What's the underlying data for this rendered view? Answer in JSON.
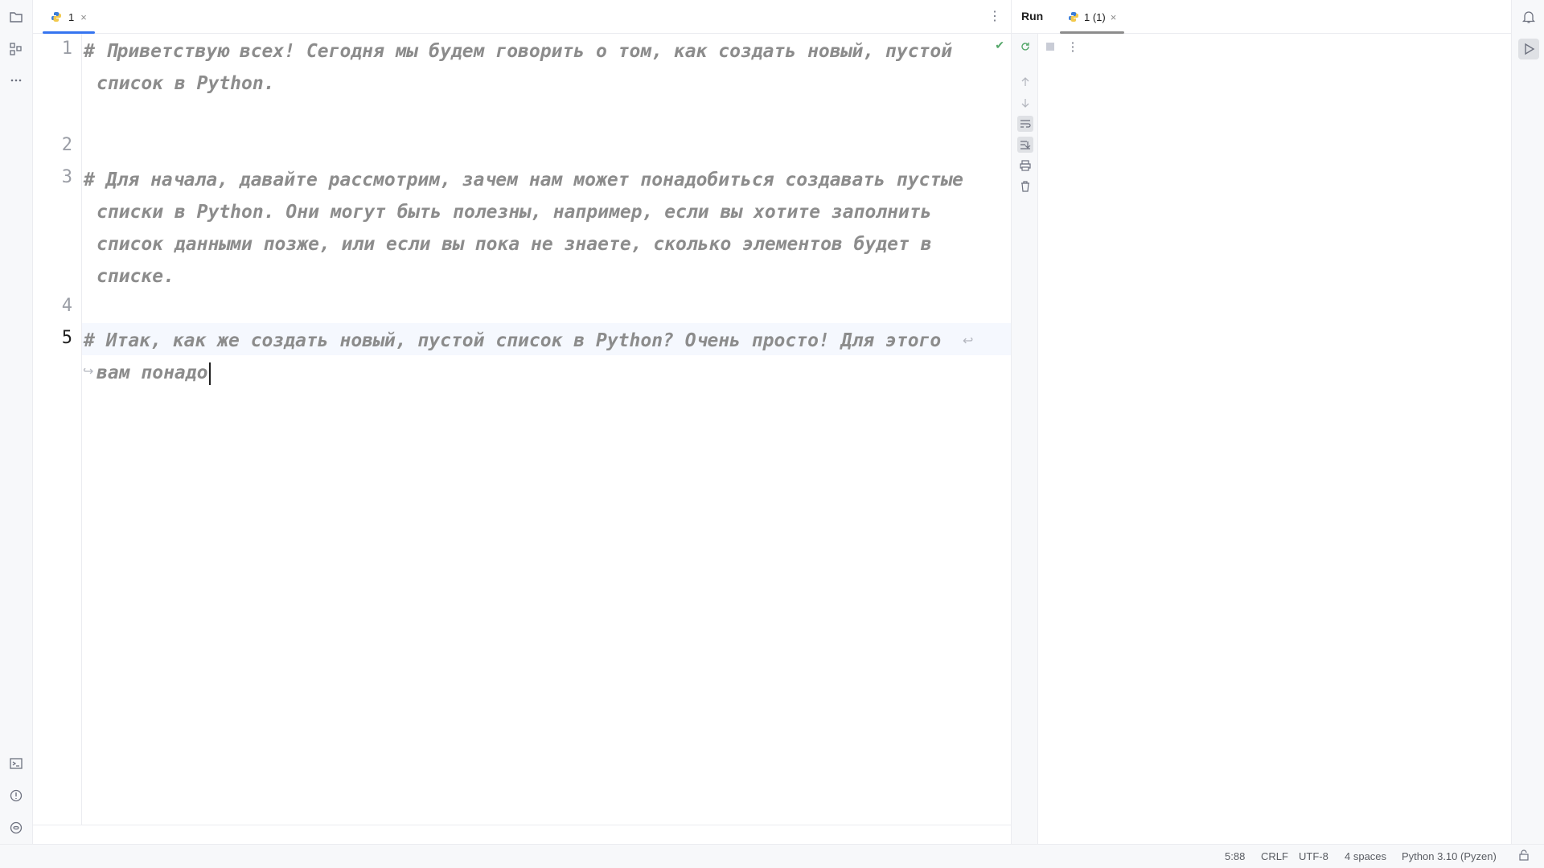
{
  "editor": {
    "tab_label": "1",
    "tab_close": "×",
    "menu_icon": "⋮",
    "status_check": "✔",
    "line_numbers": [
      "1",
      "2",
      "3",
      "4",
      "5"
    ],
    "lines": {
      "l1a": "# Приветствую всех! Сегодня мы будем говорить о том, как создать новый, пустой",
      "l1b": "список в Python.",
      "l3a": "# Для начала, давайте рассмотрим, зачем нам может понадобиться создавать пустые",
      "l3b": "списки в Python. Они могут быть полезны, например, если вы хотите заполнить",
      "l3c": "список данными позже, или если вы пока не знаете, сколько элементов будет в",
      "l3d": "списке.",
      "l5a": "# Итак, как же создать новый, пустой список в Python? Очень просто! Для этого",
      "l5b": "вам понадо"
    }
  },
  "run_panel": {
    "title": "Run",
    "tab_label": "1 (1)",
    "tab_close": "×",
    "menu_icon": "⋮"
  },
  "status_bar": {
    "position": "5:88",
    "line_separator": "CRLF",
    "encoding": "UTF-8",
    "indent": "4 spaces",
    "interpreter": "Python 3.10 (Pyzen)"
  }
}
